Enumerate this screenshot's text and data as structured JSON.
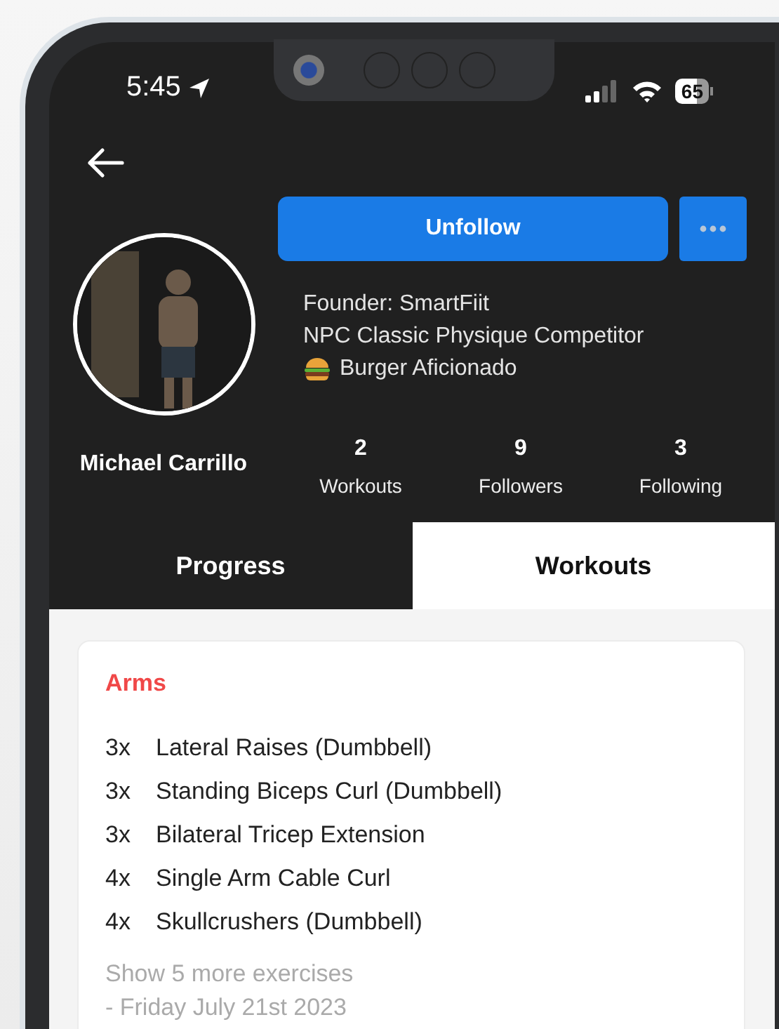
{
  "status_bar": {
    "time": "5:45",
    "battery": "65"
  },
  "header": {
    "primary_button": "Unfollow"
  },
  "profile": {
    "name": "Michael Carrillo",
    "bio": [
      {
        "text": "Founder: SmartFiit"
      },
      {
        "text": "NPC Classic Physique Competitor"
      },
      {
        "text": "Burger Aficionado",
        "kind": "emoji"
      }
    ],
    "stats": [
      {
        "value": "2",
        "label": "Workouts"
      },
      {
        "value": "9",
        "label": "Followers"
      },
      {
        "value": "3",
        "label": "Following"
      }
    ]
  },
  "tabs": [
    {
      "label": "Progress",
      "selected": false
    },
    {
      "label": "Workouts",
      "selected": true
    }
  ],
  "workouts": [
    {
      "title": "Arms",
      "exercises": [
        {
          "sets": "3x",
          "name": "Lateral Raises (Dumbbell)"
        },
        {
          "sets": "3x",
          "name": "Standing Biceps Curl (Dumbbell)"
        },
        {
          "sets": "3x",
          "name": "Bilateral Tricep Extension"
        },
        {
          "sets": "4x",
          "name": "Single Arm Cable Curl"
        },
        {
          "sets": "4x",
          "name": "Skullcrushers (Dumbbell)"
        }
      ],
      "more_link": "Show 5 more exercises",
      "date": "- Friday July 21st 2023"
    }
  ]
}
